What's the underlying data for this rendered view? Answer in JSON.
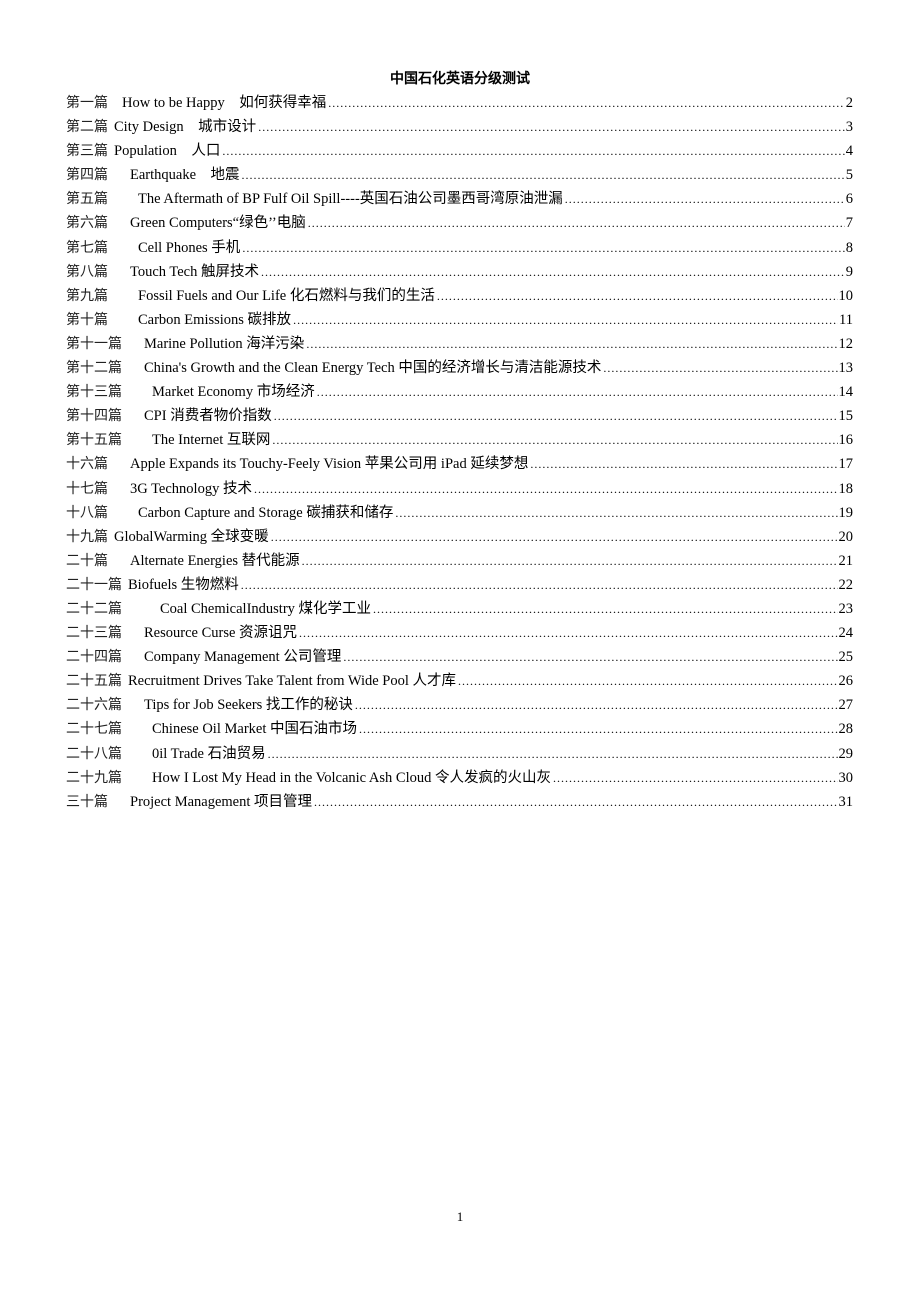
{
  "document": {
    "title": "中国石化英语分级测试",
    "footer_page_number": "1",
    "toc": [
      {
        "number": "第一篇",
        "gap": 14,
        "title": "How to be Happy　如何获得幸福",
        "page": "2"
      },
      {
        "number": "第二篇",
        "gap": 6,
        "title": "City Design　城市设计",
        "page": "3"
      },
      {
        "number": "第三篇",
        "gap": 6,
        "title": "Population　人口",
        "page": "4"
      },
      {
        "number": "第四篇",
        "gap": 22,
        "title": "Earthquake　地震",
        "page": "5"
      },
      {
        "number": "第五篇",
        "gap": 30,
        "title": "The Aftermath of BP Fulf Oil Spill----英国石油公司墨西哥湾原油泄漏",
        "page": "6"
      },
      {
        "number": "第六篇",
        "gap": 22,
        "title": "Green Computers“绿色’’电脑",
        "page": "7"
      },
      {
        "number": "第七篇",
        "gap": 30,
        "title": "Cell Phones 手机",
        "page": "8"
      },
      {
        "number": "第八篇",
        "gap": 22,
        "title": "Touch Tech 触屏技术",
        "page": "9"
      },
      {
        "number": "第九篇",
        "gap": 30,
        "title": "Fossil Fuels and Our Life 化石燃料与我们的生活",
        "page": "10"
      },
      {
        "number": "第十篇",
        "gap": 30,
        "title": "Carbon Emissions 碳排放",
        "page": "11"
      },
      {
        "number": "第十一篇",
        "gap": 22,
        "title": "Marine Pollution 海洋污染",
        "page": "12"
      },
      {
        "number": "第十二篇",
        "gap": 22,
        "title": "China's Growth and the Clean Energy Tech 中国的经济增长与清洁能源技术",
        "page": "13"
      },
      {
        "number": "第十三篇",
        "gap": 30,
        "title": "Market Economy 市场经济",
        "page": "14"
      },
      {
        "number": "第十四篇",
        "gap": 22,
        "title": "CPI 消费者物价指数",
        "page": "15"
      },
      {
        "number": "第十五篇",
        "gap": 30,
        "title": "The Internet 互联网",
        "page": "16"
      },
      {
        "number": "十六篇",
        "gap": 22,
        "title": "Apple Expands its Touchy-Feely Vision 苹果公司用 iPad 延续梦想",
        "page": "17"
      },
      {
        "number": "十七篇",
        "gap": 22,
        "title": "3G Technology 技术",
        "page": "18"
      },
      {
        "number": "十八篇",
        "gap": 30,
        "title": "Carbon Capture and Storage 碳捕获和储存",
        "page": "19"
      },
      {
        "number": "十九篇",
        "gap": 6,
        "title": "GlobalWarming 全球变暖",
        "page": "20"
      },
      {
        "number": "二十篇",
        "gap": 22,
        "title": "Alternate Energies 替代能源",
        "page": "21"
      },
      {
        "number": "二十一篇",
        "gap": 6,
        "title": "Biofuels 生物燃料",
        "page": "22"
      },
      {
        "number": "二十二篇",
        "gap": 38,
        "title": "Coal ChemicalIndustry 煤化学工业",
        "page": "23"
      },
      {
        "number": "二十三篇",
        "gap": 22,
        "title": "Resource Curse 资源诅咒",
        "page": "24"
      },
      {
        "number": "二十四篇",
        "gap": 22,
        "title": "Company Management 公司管理",
        "page": "25"
      },
      {
        "number": "二十五篇",
        "gap": 6,
        "title": "Recruitment Drives Take Talent from Wide Pool 人才库",
        "page": "26"
      },
      {
        "number": "二十六篇",
        "gap": 22,
        "title": "Tips for Job Seekers 找工作的秘诀",
        "page": "27"
      },
      {
        "number": "二十七篇",
        "gap": 30,
        "title": "Chinese Oil Market 中国石油市场",
        "page": "28"
      },
      {
        "number": "二十八篇",
        "gap": 30,
        "title": "0il Trade 石油贸易",
        "page": "29"
      },
      {
        "number": "二十九篇",
        "gap": 30,
        "title": "How I Lost My Head in the Volcanic Ash Cloud 令人发疯的火山灰",
        "page": "30"
      },
      {
        "number": "三十篇",
        "gap": 22,
        "title": "Project Management 项目管理",
        "page": "31"
      }
    ]
  }
}
